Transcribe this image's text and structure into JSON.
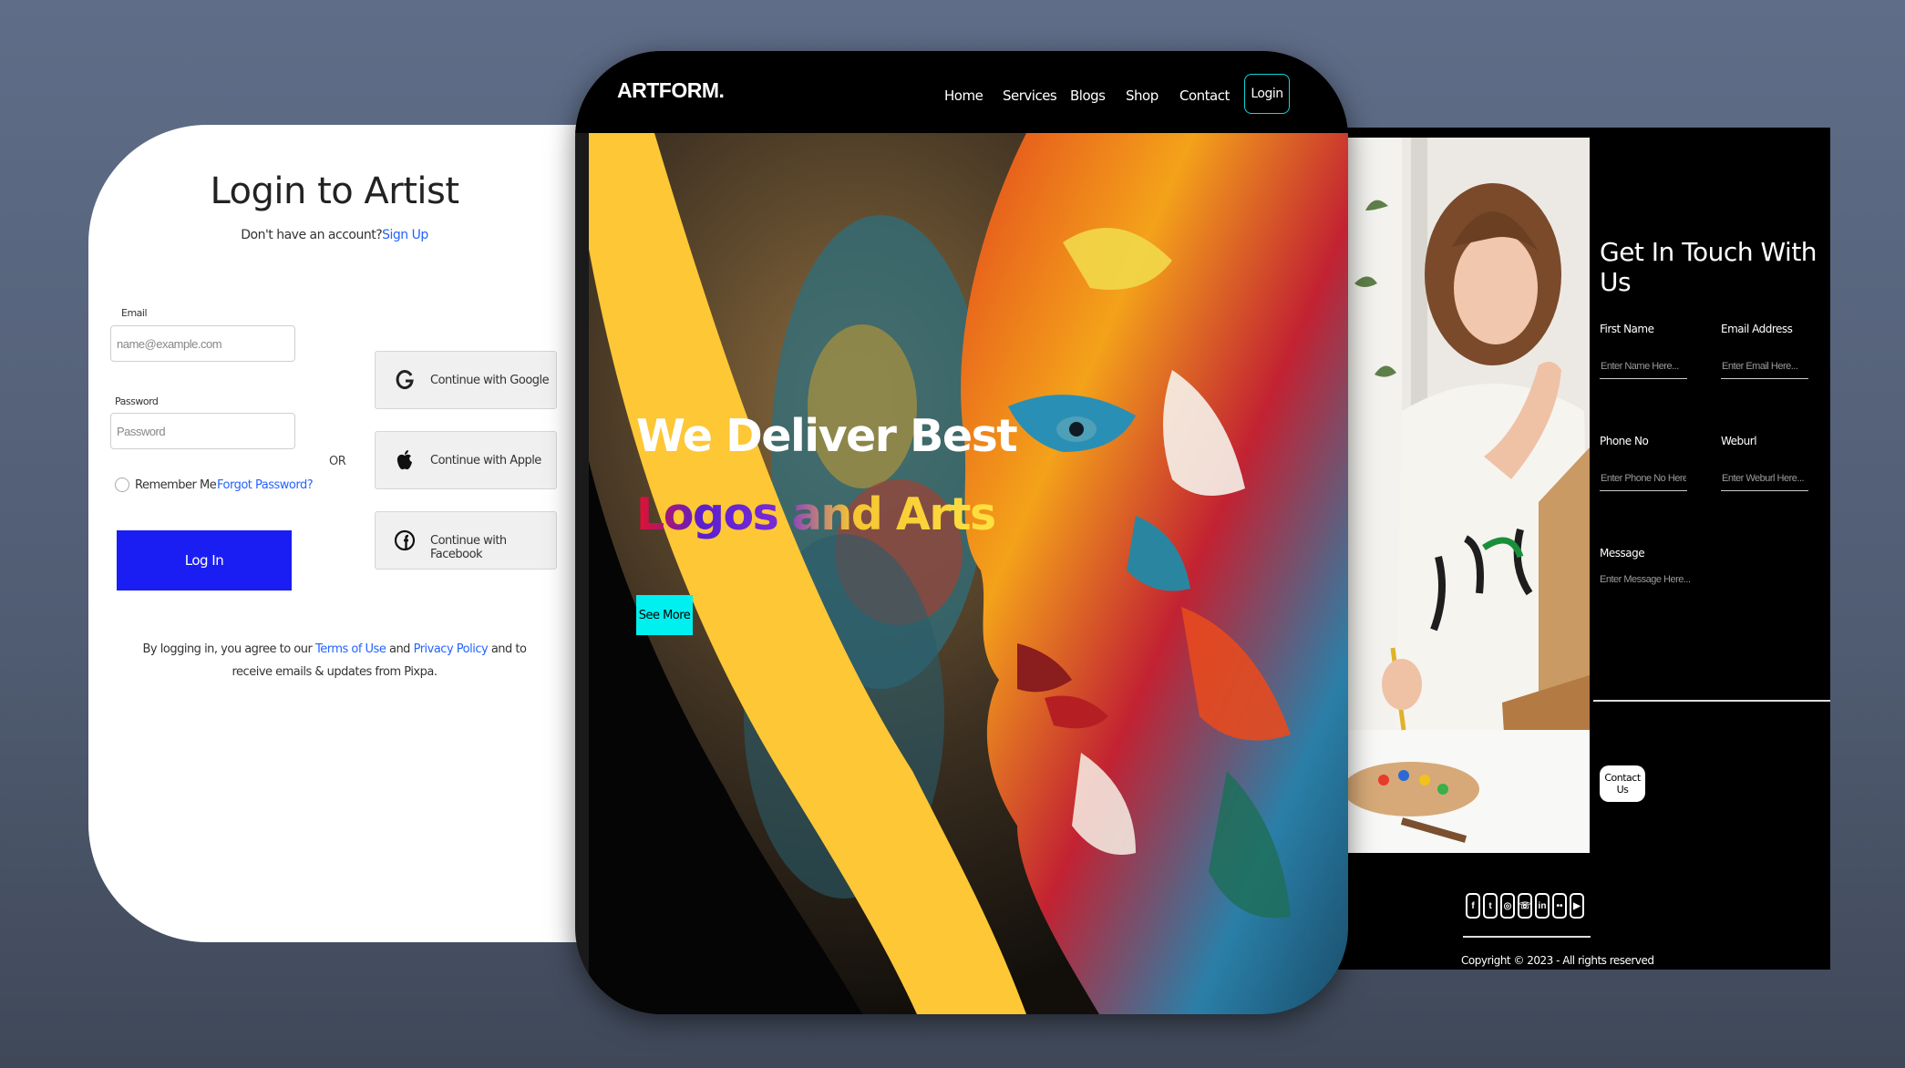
{
  "login": {
    "title": "Login to Artist",
    "subtitle_prefix": "Don't have an account?",
    "signup_link": "Sign Up",
    "email_label": "Email",
    "email_placeholder": "name@example.com",
    "password_label": "Password",
    "password_placeholder": "Password",
    "remember_label": "Remember Me",
    "forgot_label": "Forgot Password?",
    "login_button": "Log In",
    "or_label": "OR",
    "social": [
      {
        "label": "Continue with Google",
        "icon": "google-icon"
      },
      {
        "label": "Continue with Apple",
        "icon": "apple-icon"
      },
      {
        "label": "Continue with Facebook",
        "icon": "facebook-icon"
      }
    ],
    "terms": {
      "prefix": "By logging in, you agree to our ",
      "terms_link": "Terms of Use",
      "and": " and ",
      "privacy_link": "Privacy Policy",
      "suffix": " and to",
      "line2": "receive emails & updates from Pixpa."
    }
  },
  "hero": {
    "brand": "ARTFORM.",
    "nav": [
      "Home",
      "Services",
      "Blogs",
      "Shop",
      "Contact"
    ],
    "login_button": "Login",
    "headline_line1": "We Deliver Best",
    "headline_line2": "Logos and Arts",
    "cta": "See More",
    "colors": {
      "accent_yellow": "#fdc735",
      "cyan": "#00f0f0",
      "nav_border": "#14d6d6"
    }
  },
  "contact": {
    "title": "Get In Touch With Us",
    "first_name_label": "First Name",
    "first_name_placeholder": "Enter Name Here...",
    "email_label": "Email Address",
    "email_placeholder": "Enter Email Here...",
    "phone_label": "Phone No",
    "phone_placeholder": "Enter Phone No Here...",
    "weburl_label": "Weburl",
    "weburl_placeholder": "Enter Weburl Here...",
    "message_label": "Message",
    "message_placeholder": "Enter Message Here...",
    "button": "Contact Us",
    "social_icons": [
      "facebook-icon",
      "twitter-icon",
      "instagram-icon",
      "whatsapp-icon",
      "linkedin-icon",
      "flickr-icon",
      "youtube-icon"
    ],
    "copyright": "Copyright © 2023 - All rights reserved"
  },
  "colors": {
    "primary_blue": "#1b1ef2",
    "link_blue": "#2463ff",
    "background": "#5a6780"
  }
}
